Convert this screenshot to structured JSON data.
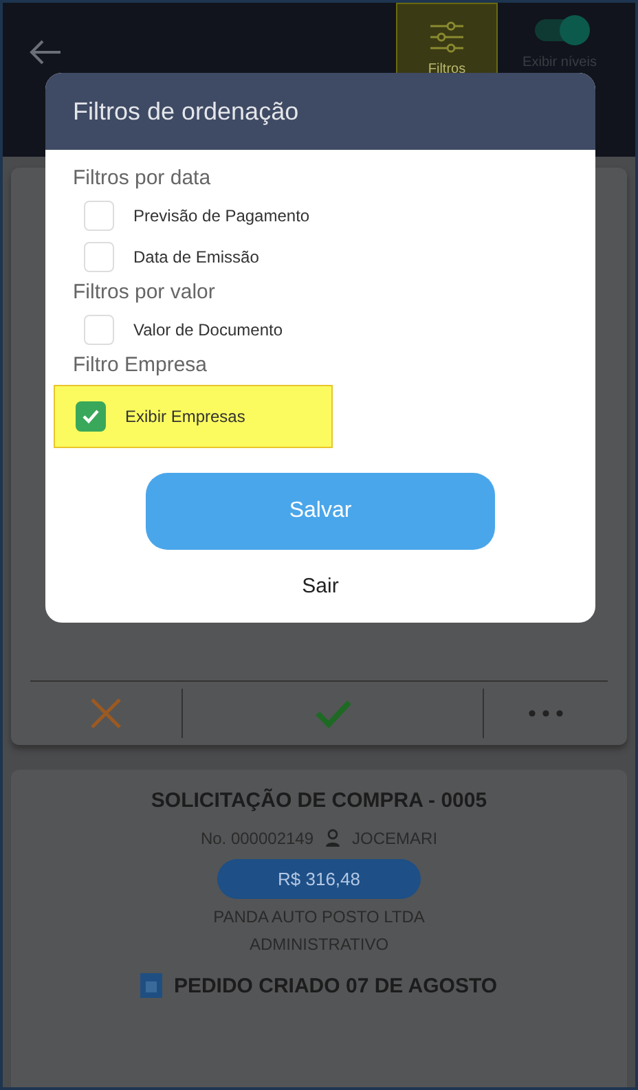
{
  "top_bar": {
    "filter_button": {
      "label": "Filtros",
      "highlighted": true
    },
    "levels_toggle": {
      "label": "Exibir níveis",
      "on": true
    }
  },
  "action_row": {
    "items": [
      {
        "kind": "reject"
      },
      {
        "kind": "approve"
      },
      {
        "kind": "more"
      }
    ]
  },
  "card": {
    "title": "SOLICITAÇÃO DE COMPRA - 0005",
    "number": "No. 000002149",
    "user": "JOCEMARI",
    "amount": "R$ 316,48",
    "company": "PANDA AUTO POSTO LTDA",
    "department": "ADMINISTRATIVO",
    "status": "PEDIDO CRIADO 07 DE AGOSTO"
  },
  "dialog": {
    "title": "Filtros de ordenação",
    "groups": [
      {
        "heading": "Filtros por data",
        "options": [
          {
            "label": "Previsão de Pagamento",
            "checked": false,
            "highlighted": false
          },
          {
            "label": "Data de Emissão",
            "checked": false,
            "highlighted": false
          }
        ]
      },
      {
        "heading": "Filtros por valor",
        "options": [
          {
            "label": "Valor de Documento",
            "checked": false,
            "highlighted": false
          }
        ]
      },
      {
        "heading": "Filtro Empresa",
        "options": [
          {
            "label": "Exibir Empresas",
            "checked": true,
            "highlighted": true
          }
        ]
      }
    ],
    "save_button": "Salvar",
    "exit_button": "Sair"
  }
}
